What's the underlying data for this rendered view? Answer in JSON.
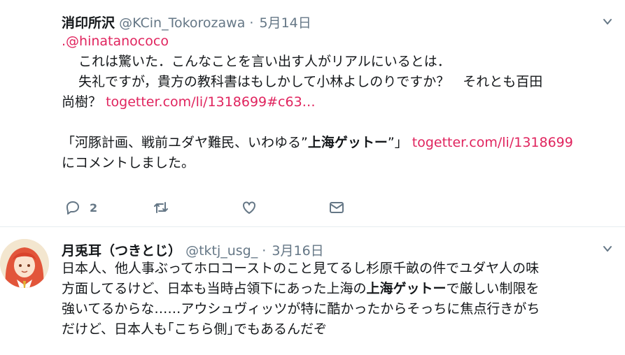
{
  "tweet1": {
    "name": "消印所沢",
    "handle": "@KCin_Tokorozawa",
    "sep": "·",
    "date": "5月14日",
    "mention": ".@hinatanococo",
    "line2": "これは驚いた．こんなことを言い出す人がリアルにいるとは．",
    "line3": "失礼ですが，貴方の教科書はもしかして小林よしのりですか？　それとも百田",
    "line4_text": "尚樹？",
    "line4_link": "togetter.com/li/1318699#c63…",
    "line6_pre": "「河豚計画、戦前ユダヤ難民、いわゆる”",
    "line6_bold": "上海ゲットー",
    "line6_post": "”」",
    "line6_link": "togetter.com/li/1318699",
    "line7": "にコメントしました。",
    "reply_count": "2"
  },
  "tweet2": {
    "name": "月兎耳（つきとじ）",
    "handle": "@tktj_usg_",
    "sep": "·",
    "date": "3月16日",
    "line1": "日本人、他人事ぶってホロコーストのこと見てるし杉原千畝の件でユダヤ人の味",
    "line2_pre": "方面してるけど、日本も当時占領下にあった上海の",
    "line2_bold": "上海ゲットー",
    "line2_post": "で厳しい制限を",
    "line3": "強いてるからな……アウシュヴィッツが特に酷かったからそっちに焦点行きがち",
    "line4": "だけど、日本人も｢こちら側｣でもあるんだぞ"
  },
  "icons": {
    "reply": "reply-icon",
    "retweet": "retweet-icon",
    "like": "heart-icon",
    "dm": "envelope-icon",
    "caret": "chevron-down-icon"
  },
  "colors": {
    "link": "#e0245e",
    "muted": "#657786",
    "text": "#14171a"
  }
}
